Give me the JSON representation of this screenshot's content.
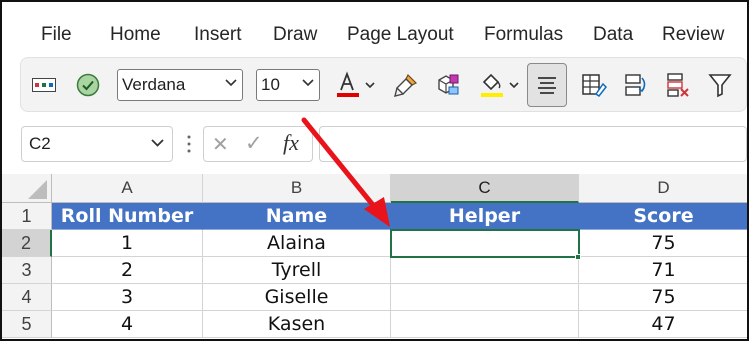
{
  "menu": [
    "File",
    "Home",
    "Insert",
    "Draw",
    "Page Layout",
    "Formulas",
    "Data",
    "Review"
  ],
  "ribbon": {
    "font_name": "Verdana",
    "font_size": "10",
    "font_color": "#e00000",
    "highlight_color": "#ffee00",
    "icons": [
      "number-format-icon",
      "accessibility-check-icon",
      "format-painter-icon",
      "styles-icon",
      "fill-color-icon",
      "align-center-icon",
      "conditional-format-icon",
      "refresh-icon",
      "delete-icon",
      "filter-icon"
    ]
  },
  "formula_bar": {
    "name_box": "C2",
    "cancel_symbol": "✕",
    "enter_symbol": "✓",
    "fx_label": "fx",
    "formula": ""
  },
  "sheet": {
    "columns": [
      "A",
      "B",
      "C",
      "D"
    ],
    "rows": [
      "1",
      "2",
      "3",
      "4",
      "5"
    ],
    "selected_column": "C",
    "selected_row": "2",
    "active_cell": "C2",
    "header_fill": "#4472c4",
    "cells": [
      [
        "Roll Number",
        "Name",
        "Helper",
        "Score"
      ],
      [
        "1",
        "Alaina",
        "",
        "75"
      ],
      [
        "2",
        "Tyrell",
        "",
        "71"
      ],
      [
        "3",
        "Giselle",
        "",
        "75"
      ],
      [
        "4",
        "Kasen",
        "",
        "47"
      ]
    ]
  },
  "annotation": {
    "arrow_color": "#e8131b"
  }
}
